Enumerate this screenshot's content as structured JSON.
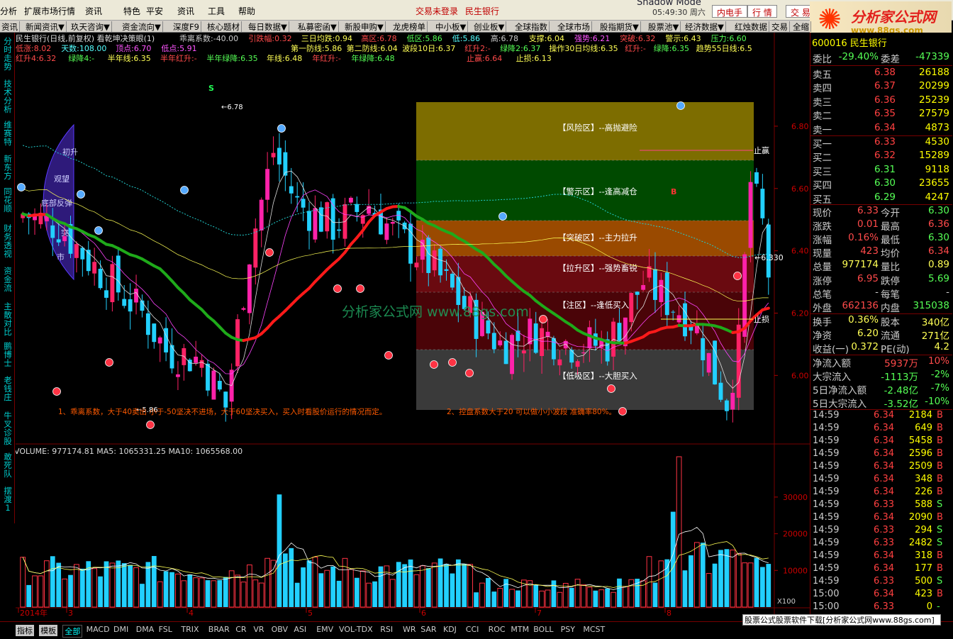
{
  "menu": {
    "items": [
      "分析",
      "扩展市场行情",
      "资讯",
      "特色",
      "平安",
      "资讯",
      "工具",
      "帮助"
    ],
    "status1": "交易未登录",
    "status2": "民生银行",
    "shadow_mode": "Shadow Mode",
    "clock": "05:49:30 周六",
    "btn_neidian": "内电手",
    "btn_hangqing": "行 情",
    "btn_jiaoyi": "交 易"
  },
  "logo": {
    "title": "分析家公式网",
    "url": "www.88gs.com"
  },
  "toolbar": [
    "资讯",
    "新闻资讯▼",
    "玖天咨询▼",
    "资金流向▼",
    "深度F9",
    "核心题材",
    "每日数据▼",
    "私募密函▼",
    "新股申购▼",
    "龙虎榜单",
    "中小板▼",
    "创业板▼",
    "全球指数",
    "全球市场",
    "股指期货▼",
    "股票池▼",
    "经济数据▼",
    "红烛数据",
    "交易",
    "全缩"
  ],
  "leftbar": [
    "分时走势",
    "技术分析",
    "维赛特",
    "新东方",
    "同花顺",
    "财务透视",
    "资金流",
    "主散对比",
    "鹏博士",
    "老钱庄",
    "牛叉诊股",
    "敢死队",
    "摆渡1"
  ],
  "header": {
    "line1_title": "民生银行(日线,前复权) 看乾坤决策眼(1)",
    "line1_items": [
      {
        "label": "乖离系数:",
        "value": "-40.00",
        "color": "#ccc"
      },
      {
        "label": "引跌幅:",
        "value": "0.32",
        "color": "#ff4a4a"
      },
      {
        "label": "三日均跌:",
        "value": "0.94",
        "color": "#ffff55"
      },
      {
        "label": "高区:",
        "value": "6.78",
        "color": "#ff4a4a"
      },
      {
        "label": "低区:",
        "value": "5.86",
        "color": "#55ff55"
      },
      {
        "label": "低:",
        "value": "5.86",
        "color": "#55ffff"
      },
      {
        "label": "高:",
        "value": "6.78",
        "color": "#ccc"
      },
      {
        "label": "支撑:",
        "value": "6.04",
        "color": "#ffff55"
      },
      {
        "label": "强势:",
        "value": "6.21",
        "color": "#ff55ff"
      },
      {
        "label": "突破:",
        "value": "6.32",
        "color": "#ff4a4a"
      },
      {
        "label": "警示:",
        "value": "6.43",
        "color": "#ffff55"
      },
      {
        "label": "压力:",
        "value": "6.60",
        "color": "#55ff55"
      }
    ],
    "line2_items": [
      {
        "label": "低涨:",
        "value": "8.02",
        "color": "#ff4a4a"
      },
      {
        "label": "天数:",
        "value": "108.00",
        "color": "#55ffff"
      },
      {
        "label": "顶点:",
        "value": "6.70",
        "color": "#ff55ff"
      },
      {
        "label": "低点:",
        "value": "5.91",
        "color": "#ff55ff"
      },
      {
        "label": "第一防线:",
        "value": "5.86",
        "color": "#ffff55"
      },
      {
        "label": "第二防线:",
        "value": "6.04",
        "color": "#ffff55"
      },
      {
        "label": "波段10日:",
        "value": "6.37",
        "color": "#ffff55"
      },
      {
        "label": "红升2:",
        "value": "-",
        "color": "#ff4a4a"
      },
      {
        "label": "绿降2:",
        "value": "6.37",
        "color": "#55ff55"
      },
      {
        "label": "操作30日均线:",
        "value": "6.35",
        "color": "#ffff55"
      },
      {
        "label": "红升:",
        "value": "-",
        "color": "#ff4a4a"
      },
      {
        "label": "绿降:",
        "value": "6.35",
        "color": "#55ff55"
      },
      {
        "label": "趋势55日线:",
        "value": "6.5",
        "color": "#ffff55"
      }
    ],
    "line3_items": [
      {
        "label": "红升4:",
        "value": "6.32",
        "color": "#ff4a4a"
      },
      {
        "label": "绿降4:",
        "value": "-",
        "color": "#55ff55"
      },
      {
        "label": "半年线:",
        "value": "6.35",
        "color": "#ffff55"
      },
      {
        "label": "半年红升:",
        "value": "-",
        "color": "#ff4a4a"
      },
      {
        "label": "半年绿降:",
        "value": "6.35",
        "color": "#55ff55"
      },
      {
        "label": "年线:",
        "value": "6.48",
        "color": "#ffff55"
      },
      {
        "label": "年红升:",
        "value": "-",
        "color": "#ff4a4a"
      },
      {
        "label": "年绿降:",
        "value": "6.48",
        "color": "#55ff55"
      },
      {
        "label": "止赢:",
        "value": "6.64",
        "color": "#ff4a4a"
      },
      {
        "label": "止损:",
        "value": "6.13",
        "color": "#ffff55"
      }
    ]
  },
  "zones": [
    {
      "label": "【风险区】--高抛避险",
      "color": "#7d6d00"
    },
    {
      "label": "【警示区】--逢高减仓",
      "color": "#004a00"
    },
    {
      "label": "【突破区】--主力拉升",
      "color": "#9a4a00"
    },
    {
      "label": "【拉升区】--强势畜锐",
      "color": "#6a0a10"
    },
    {
      "label": "【注区】--逢低买入",
      "color": "#4a0408"
    },
    {
      "label": "【低吸区】--大胆买入",
      "color": "#3a3a3a"
    }
  ],
  "annotations": {
    "take_profit": "止赢",
    "stop_loss": "止损",
    "high_mark": "6.78",
    "low_mark": "5.86",
    "last_mark": "6.330",
    "watermark": "分析家公式网 www.88gs.com",
    "note1": "1、乖离系数，大于40卖出 小于-50坚决不进场，大于60坚决买入，买入时看股价运行的情况而定。",
    "note2": "2、控盘系数大于20 可以做小小波段 准确率80%。",
    "s_mark": "S",
    "b_mark": "B",
    "dial_words": [
      "初升",
      "观望",
      "底部反弹",
      "突",
      "市"
    ]
  },
  "volume": {
    "label": "VOLUME: 977174.81  MA5: 1065331.25  MA10: 1065568.00",
    "scale_label": "X100"
  },
  "chart_data": {
    "type": "candlestick",
    "title": "民生银行(日线,前复权)",
    "price_axis_ticks": [
      6.8,
      6.6,
      6.4,
      6.2,
      6.0
    ],
    "volume_axis_ticks": [
      30000,
      20000,
      10000
    ],
    "date_axis_labels": [
      "2014年",
      "3",
      "4",
      "5",
      "6",
      "7",
      "8"
    ],
    "price_range": [
      5.78,
      6.9
    ]
  },
  "quote": {
    "stock": "600016  民生银行",
    "weibi_label": "委比",
    "weibi": "-29.40%",
    "weicha_label": "委差",
    "weicha": "-47339",
    "sells": [
      {
        "label": "卖五",
        "price": "6.38",
        "vol": "26188"
      },
      {
        "label": "卖四",
        "price": "6.37",
        "vol": "20299"
      },
      {
        "label": "卖三",
        "price": "6.36",
        "vol": "25239"
      },
      {
        "label": "卖二",
        "price": "6.35",
        "vol": "27579"
      },
      {
        "label": "卖一",
        "price": "6.34",
        "vol": "4873"
      }
    ],
    "buys": [
      {
        "label": "买一",
        "price": "6.33",
        "vol": "4530"
      },
      {
        "label": "买二",
        "price": "6.32",
        "vol": "15289"
      },
      {
        "label": "买三",
        "price": "6.31",
        "vol": "9118"
      },
      {
        "label": "买四",
        "price": "6.30",
        "vol": "23655"
      },
      {
        "label": "买五",
        "price": "6.29",
        "vol": "4247"
      }
    ],
    "stats": [
      {
        "l1": "现价",
        "v1": "6.33",
        "c1": "#ff4a4a",
        "l2": "今开",
        "v2": "6.30",
        "c2": "#55ff55"
      },
      {
        "l1": "涨跌",
        "v1": "0.01",
        "c1": "#ff4a4a",
        "l2": "最高",
        "v2": "6.36",
        "c2": "#ff4a4a"
      },
      {
        "l1": "涨幅",
        "v1": "0.16%",
        "c1": "#ff4a4a",
        "l2": "最低",
        "v2": "6.30",
        "c2": "#55ff55"
      },
      {
        "l1": "现量",
        "v1": "423",
        "c1": "#ff4a4a",
        "l2": "均价",
        "v2": "6.34",
        "c2": "#ff4a4a"
      },
      {
        "l1": "总量",
        "v1": "977174",
        "c1": "#ffff55",
        "l2": "量比",
        "v2": "0.89",
        "c2": "#ffff55"
      },
      {
        "l1": "涨停",
        "v1": "6.95",
        "c1": "#ff4a4a",
        "l2": "跌停",
        "v2": "5.69",
        "c2": "#55ff55"
      },
      {
        "l1": "总笔",
        "v1": "-",
        "c1": "#ccc",
        "l2": "每笔",
        "v2": "-",
        "c2": "#ccc"
      },
      {
        "l1": "外盘",
        "v1": "662136",
        "c1": "#ff4a4a",
        "l2": "内盘",
        "v2": "315038",
        "c2": "#55ff55"
      }
    ],
    "stats2": [
      {
        "l1": "换手",
        "v1": "0.36%",
        "c1": "#ffff55",
        "l2": "股本",
        "v2": "340亿",
        "c2": "#ffff55"
      },
      {
        "l1": "净资",
        "v1": "6.20",
        "c1": "#ffff55",
        "l2": "流通",
        "v2": "271亿",
        "c2": "#ffff55"
      },
      {
        "l1": "收益(一)",
        "v1": "0.372",
        "c1": "#ffff55",
        "l2": "PE(动)",
        "v2": "4.2",
        "c2": "#ffff55"
      }
    ],
    "flows": [
      {
        "label": "净流入额",
        "value": "5937万",
        "pct": "10%",
        "color": "#ff4a4a"
      },
      {
        "label": "大宗流入",
        "value": "-1113万",
        "pct": "-2%",
        "color": "#55ff55"
      },
      {
        "label": "5日净流入额",
        "value": "-2.48亿",
        "pct": "-7%",
        "color": "#55ff55"
      },
      {
        "label": "5日大宗流入",
        "value": "-3.52亿",
        "pct": "-10%",
        "color": "#55ff55"
      }
    ],
    "ticks": [
      {
        "t": "14:59",
        "p": "6.34",
        "v": "2184",
        "bs": "B"
      },
      {
        "t": "14:59",
        "p": "6.34",
        "v": "649",
        "bs": "B"
      },
      {
        "t": "14:59",
        "p": "6.34",
        "v": "5458",
        "bs": "B"
      },
      {
        "t": "14:59",
        "p": "6.34",
        "v": "2596",
        "bs": "B"
      },
      {
        "t": "14:59",
        "p": "6.34",
        "v": "2509",
        "bs": "B"
      },
      {
        "t": "14:59",
        "p": "6.34",
        "v": "348",
        "bs": "B"
      },
      {
        "t": "14:59",
        "p": "6.34",
        "v": "226",
        "bs": "B"
      },
      {
        "t": "14:59",
        "p": "6.33",
        "v": "588",
        "bs": "S"
      },
      {
        "t": "14:59",
        "p": "6.34",
        "v": "2090",
        "bs": "B"
      },
      {
        "t": "14:59",
        "p": "6.33",
        "v": "294",
        "bs": "S"
      },
      {
        "t": "14:59",
        "p": "6.33",
        "v": "2482",
        "bs": "S"
      },
      {
        "t": "14:59",
        "p": "6.34",
        "v": "318",
        "bs": "B"
      },
      {
        "t": "14:59",
        "p": "6.34",
        "v": "177",
        "bs": "B"
      },
      {
        "t": "14:59",
        "p": "6.33",
        "v": "500",
        "bs": "S"
      },
      {
        "t": "15:00",
        "p": "6.34",
        "v": "423",
        "bs": "B"
      },
      {
        "t": "15:00",
        "p": "6.33",
        "v": "0",
        "bs": "-"
      }
    ]
  },
  "bottom": {
    "tabs": [
      "指标",
      "模板",
      "全部",
      "MACD",
      "DMI",
      "DMA",
      "FSL",
      "TRIX",
      "BRAR",
      "CR",
      "VR",
      "OBV",
      "ASI",
      "EMV",
      "VOL-TDX",
      "RSI",
      "WR",
      "SAR",
      "KDJ",
      "CCI",
      "ROC",
      "MTM",
      "BOLL",
      "PSY",
      "MCST"
    ],
    "ad": "股票公式股票软件下载[分析家公式网www.88gs.com]"
  }
}
